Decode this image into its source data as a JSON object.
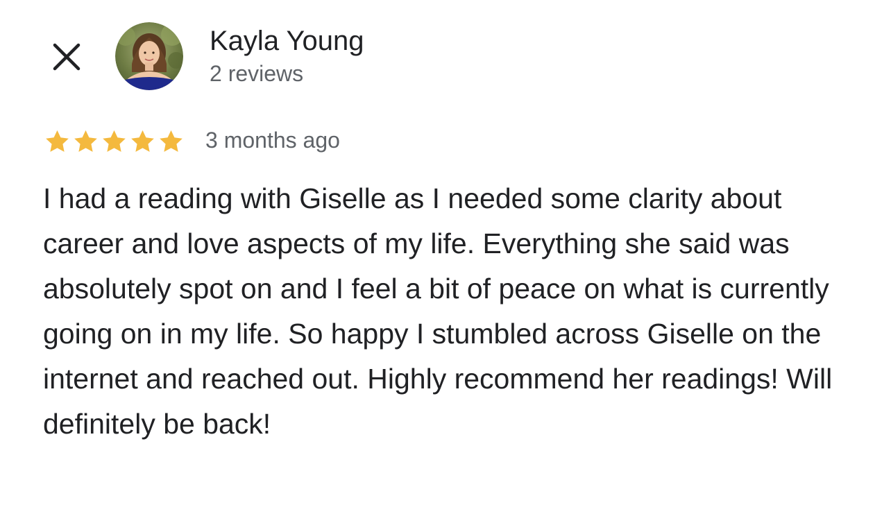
{
  "review": {
    "reviewer_name": "Kayla Young",
    "review_count": "2 reviews",
    "rating": 5,
    "rating_max": 5,
    "timestamp": "3 months ago",
    "text": "I had a reading with Giselle as I needed some clarity about career and love aspects of my life. Everything she said was absolutely spot on and I feel a bit of peace on what is currently going on in my life. So happy I stumbled across Giselle on the internet and reached out. Highly recommend her readings! Will definitely be back!"
  },
  "icons": {
    "close": "close-icon",
    "star": "star-icon",
    "avatar": "avatar-photo"
  },
  "colors": {
    "star": "#F4B93E",
    "primary_text": "#202124",
    "secondary_text": "#5f6368"
  }
}
